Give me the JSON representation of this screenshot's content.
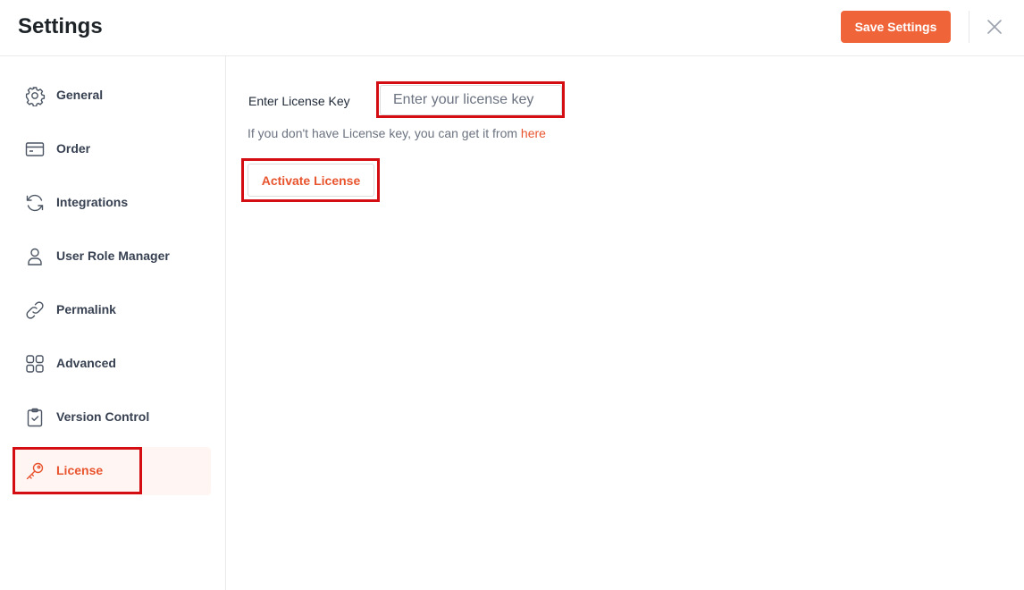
{
  "header": {
    "title": "Settings",
    "save_label": "Save Settings",
    "close_icon": "close-icon"
  },
  "sidebar": {
    "items": [
      {
        "label": "General",
        "icon": "gear-icon"
      },
      {
        "label": "Order",
        "icon": "credit-card-icon"
      },
      {
        "label": "Integrations",
        "icon": "sync-icon"
      },
      {
        "label": "User Role Manager",
        "icon": "user-icon"
      },
      {
        "label": "Permalink",
        "icon": "link-icon"
      },
      {
        "label": "Advanced",
        "icon": "grid-icon"
      },
      {
        "label": "Version Control",
        "icon": "clipboard-check-icon"
      },
      {
        "label": "License",
        "icon": "key-icon",
        "active": true
      }
    ]
  },
  "license": {
    "field_label": "Enter License Key",
    "input_value": "",
    "input_placeholder": "Enter your license key",
    "help_text": "If you don't have License key, you can get it from",
    "help_link": "here",
    "activate_label": "Activate License"
  },
  "colors": {
    "accent": "#f0643a",
    "accent_text": "#e8542e",
    "highlight_border": "#d40d12",
    "active_bg": "#fff6f4"
  }
}
